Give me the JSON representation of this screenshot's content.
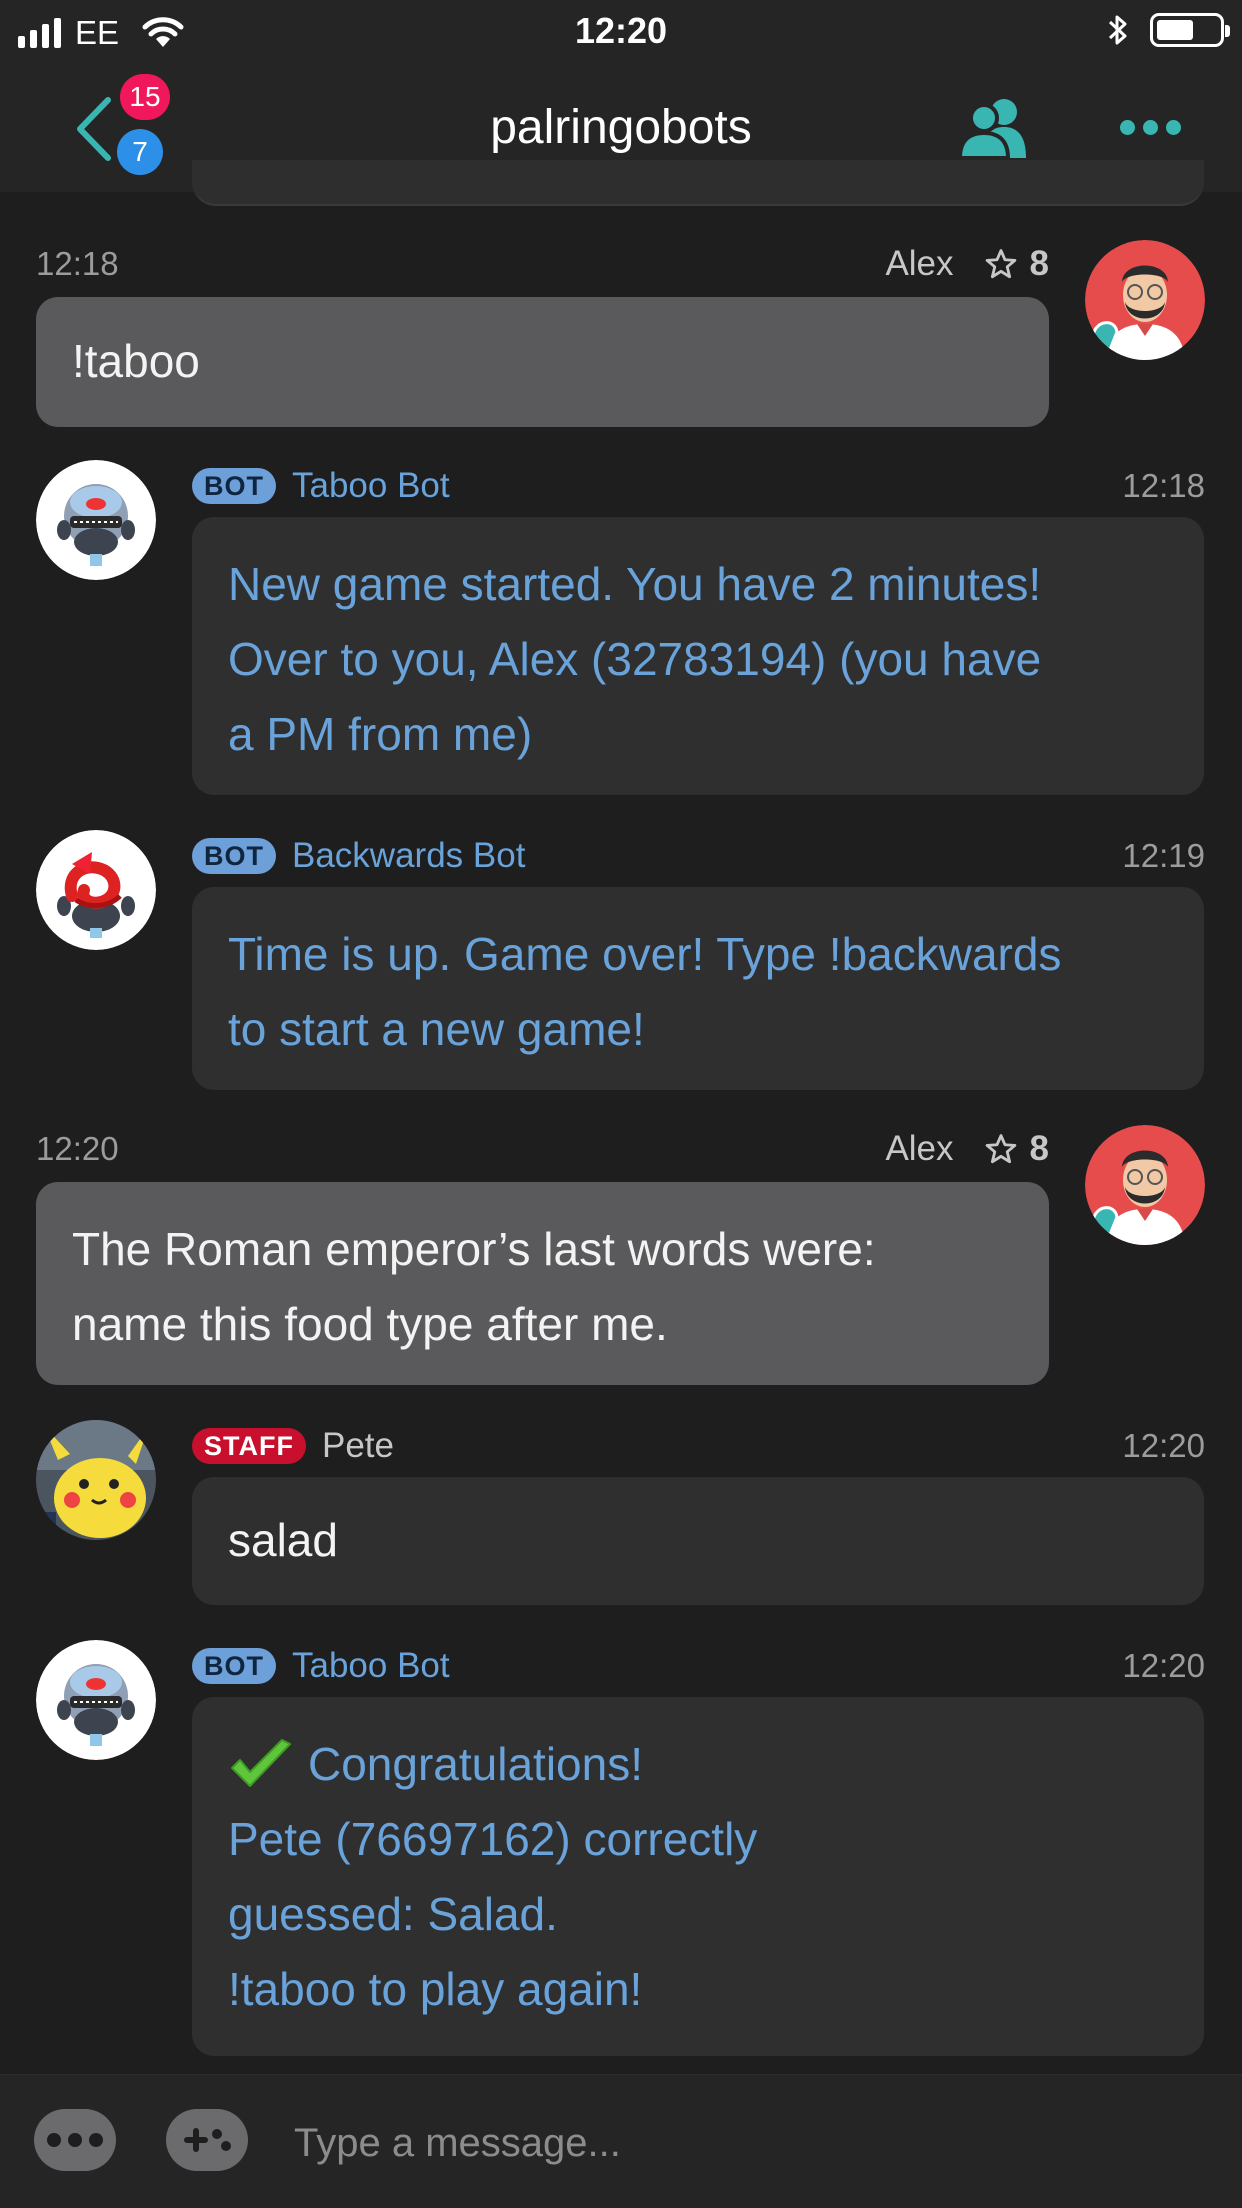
{
  "status_bar": {
    "carrier": "EE",
    "time": "12:20",
    "battery_level": 0.6
  },
  "nav": {
    "title": "palringobots",
    "badge_top": "15",
    "badge_bottom": "7",
    "accent": "#3ab6b2"
  },
  "messages": [
    {
      "time": "12:18",
      "sender": "Alex",
      "reputation": "8",
      "text": "!taboo",
      "outgoing": true
    },
    {
      "tag": "BOT",
      "sender": "Taboo Bot",
      "time": "12:18",
      "lines": [
        "New game started. You have 2 minutes!",
        "Over to you, Alex (32783194) (you have",
        "a PM from me)"
      ],
      "avatar": "taboo-bot-avatar"
    },
    {
      "tag": "BOT",
      "sender": "Backwards Bot",
      "time": "12:19",
      "lines": [
        "Time is up. Game over! Type !backwards",
        "to start a new game!"
      ],
      "avatar": "backwards-bot-avatar"
    },
    {
      "time": "12:20",
      "sender": "Alex",
      "reputation": "8",
      "lines": [
        "The Roman emperor’s last words were:",
        "name this food type after me."
      ],
      "outgoing": true
    },
    {
      "tag": "STAFF",
      "sender": "Pete",
      "time": "12:20",
      "text": "salad",
      "avatar": "pikachu-avatar"
    },
    {
      "tag": "BOT",
      "sender": "Taboo Bot",
      "time": "12:20",
      "lines": [
        "Congratulations!",
        "Pete (76697162) correctly",
        "guessed: Salad.",
        "!taboo to play again!"
      ],
      "avatar": "taboo-bot-avatar"
    }
  ],
  "composer": {
    "placeholder": "Type a message..."
  },
  "colors": {
    "background": "#1e1e1f",
    "bar": "#252526",
    "bot_text": "#6aa3da",
    "bot_tag": "#6d9fd8",
    "staff_tag": "#c8102e",
    "outgoing_bubble": "#5a5a5c",
    "incoming_bubble": "#2f2f30",
    "badge_pink": "#f0185a",
    "badge_blue": "#2d90e8"
  }
}
